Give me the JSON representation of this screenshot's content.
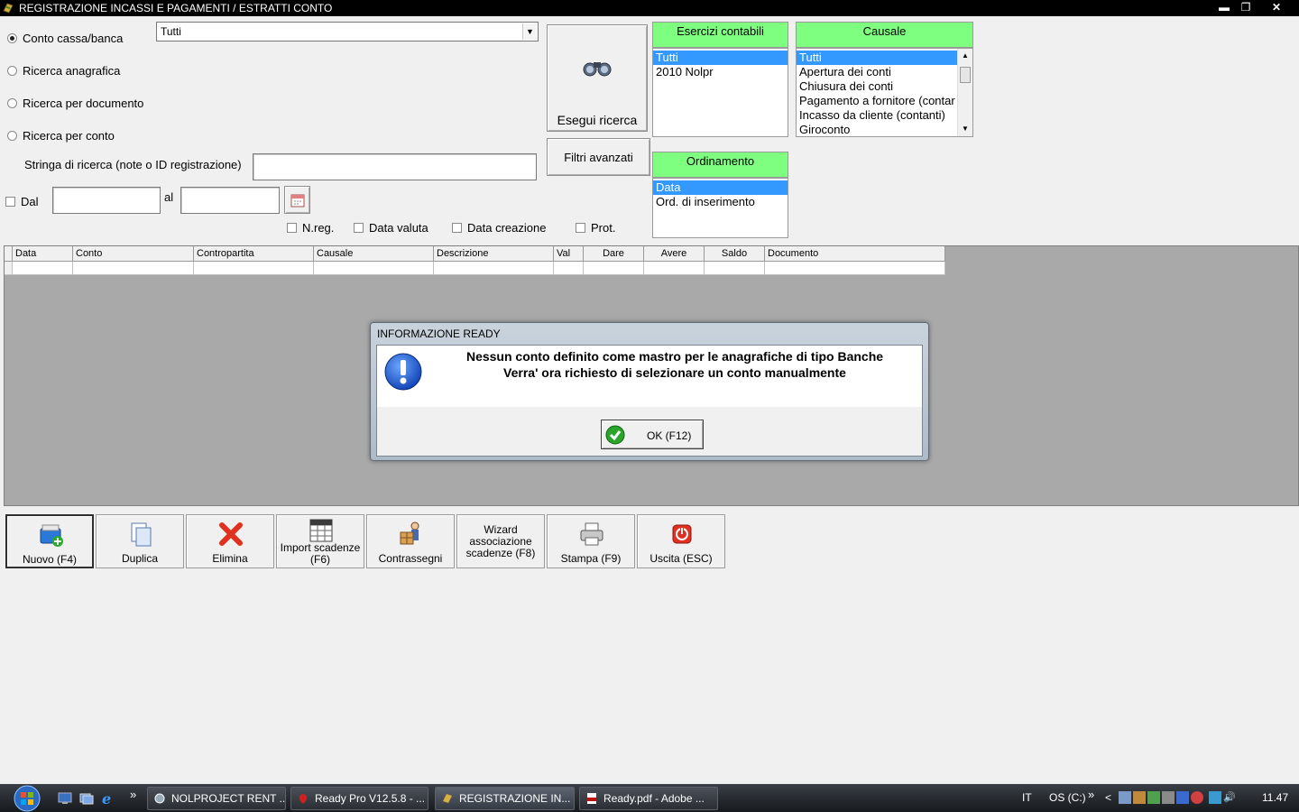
{
  "window": {
    "title": "REGISTRAZIONE INCASSI E PAGAMENTI / ESTRATTI CONTO",
    "minimize": "▬",
    "restore": "❐",
    "close": "✕"
  },
  "search_mode": {
    "options": [
      "Conto cassa/banca",
      "Ricerca anagrafica",
      "Ricerca per documento",
      "Ricerca per conto"
    ],
    "selected": "Conto cassa/banca"
  },
  "account_combo": {
    "value": "Tutti"
  },
  "search_string": {
    "label": "Stringa di ricerca (note o ID registrazione)",
    "value": ""
  },
  "date_filter": {
    "from_label": "Dal",
    "to_label": "al",
    "from_value": "",
    "to_value": ""
  },
  "checkboxes": [
    "N.reg.",
    "Data valuta",
    "Data creazione",
    "Prot."
  ],
  "buttons": {
    "search": "Esegui ricerca",
    "advanced_filters": "Filtri avanzati"
  },
  "esercizi": {
    "header": "Esercizi contabili",
    "items": [
      "Tutti",
      "2010 Nolpr"
    ],
    "selected": "Tutti"
  },
  "causale": {
    "header": "Causale",
    "items": [
      "Tutti",
      "Apertura dei conti",
      "Chiusura dei conti",
      "Pagamento a fornitore (contar",
      "Incasso da cliente (contanti)",
      "Giroconto"
    ],
    "selected": "Tutti"
  },
  "ordinamento": {
    "header": "Ordinamento",
    "items": [
      "Data",
      "Ord. di inserimento"
    ],
    "selected": "Data"
  },
  "grid": {
    "columns": [
      "Data",
      "Conto",
      "Contropartita",
      "Causale",
      "Descrizione",
      "Val",
      "Dare",
      "Avere",
      "Saldo",
      "Documento"
    ]
  },
  "dialog": {
    "title": "INFORMAZIONE READY",
    "line1": "Nessun conto definito come mastro per le anagrafiche di tipo Banche",
    "line2": "Verra' ora richiesto di selezionare un conto manualmente",
    "ok": "OK (F12)"
  },
  "toolbar": {
    "nuovo": "Nuovo (F4)",
    "duplica": "Duplica",
    "elimina": "Elimina",
    "import_l1": "Import scadenze",
    "import_l2": "(F6)",
    "contrassegni": "Contrassegni",
    "wizard_l1": "Wizard",
    "wizard_l2": "associazione",
    "wizard_l3": "scadenze (F8)",
    "stampa": "Stampa (F9)",
    "uscita": "Uscita (ESC)"
  },
  "taskbar": {
    "tasks": [
      "NOLPROJECT RENT ...",
      "Ready Pro V12.5.8 - ...",
      "REGISTRAZIONE IN...",
      "Ready.pdf - Adobe ..."
    ],
    "language": "IT",
    "drive": "OS (C:)",
    "clock": "11.47",
    "overflow": "»"
  },
  "colors": {
    "list_header": "#7fff7f",
    "selection": "#3399ff",
    "grid_bg": "#a9a9a9"
  }
}
